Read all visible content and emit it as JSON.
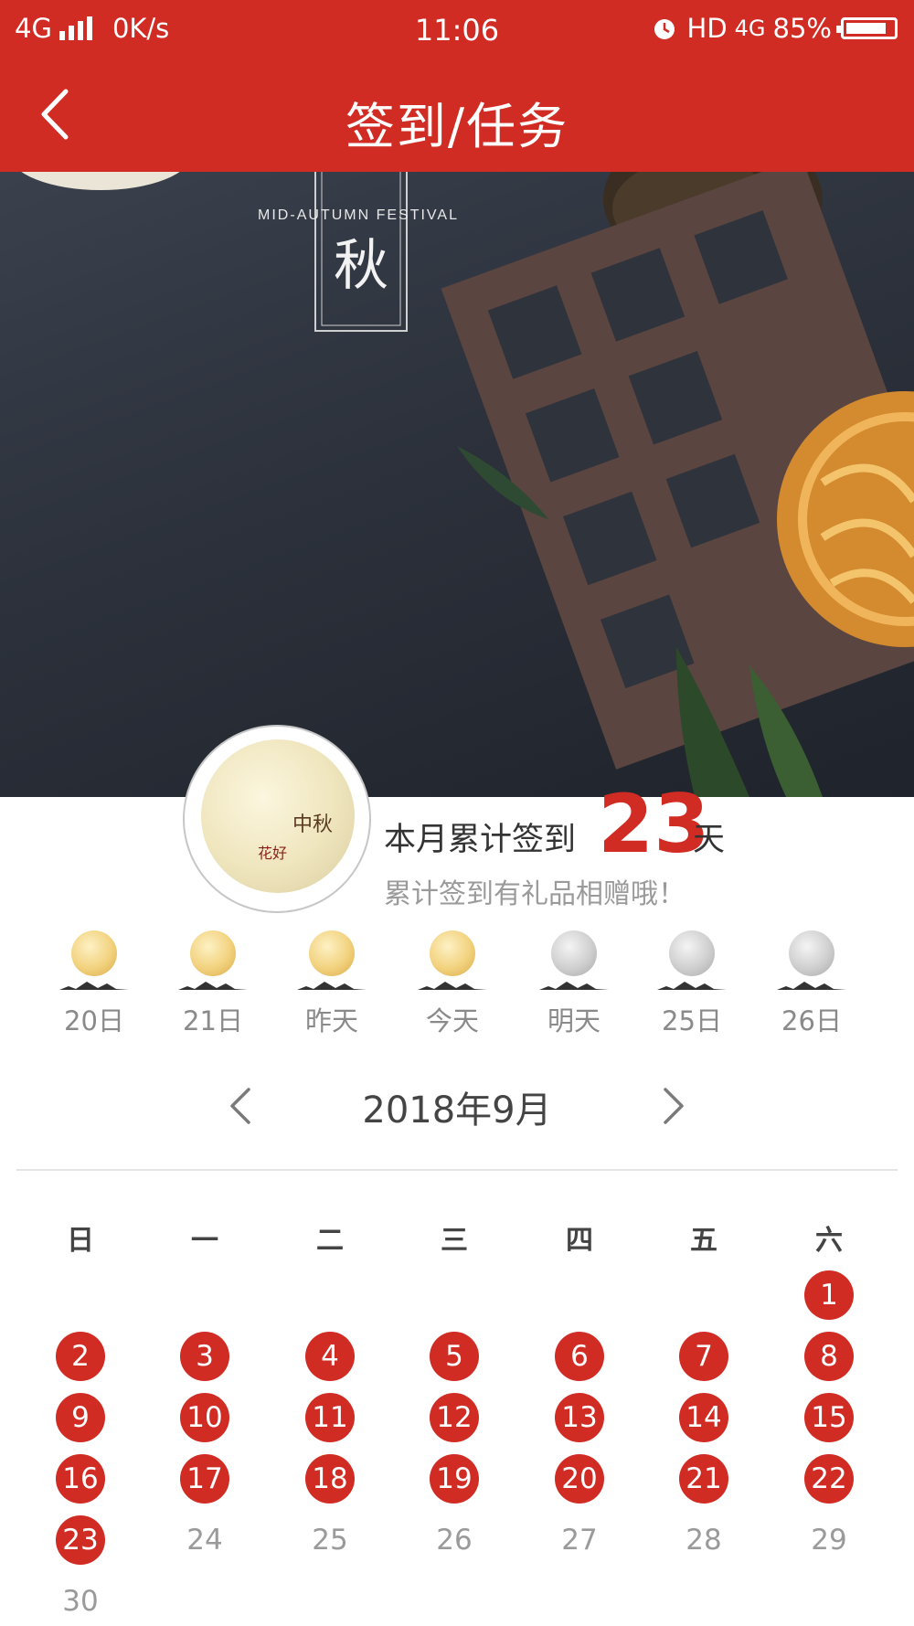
{
  "status_bar": {
    "network": "4G",
    "speed": "0K/s",
    "time": "11:06",
    "hd": "HD",
    "net2": "4G",
    "battery": "85%",
    "battery_level": 0.85
  },
  "header": {
    "title": "签到/任务",
    "back_icon": "chevron-left-icon"
  },
  "banner": {
    "festival_en": "MID-AUTUMN FESTIVAL",
    "festival_char": "秋"
  },
  "summary": {
    "prefix": "本月累计签到",
    "count": "23",
    "suffix": "天",
    "subtitle": "累计签到有礼品相赠哦！",
    "avatar_text_1": "花好",
    "avatar_text_2": "中秋"
  },
  "week_strip": [
    {
      "label": "20日",
      "signed": true
    },
    {
      "label": "21日",
      "signed": true
    },
    {
      "label": "昨天",
      "signed": true
    },
    {
      "label": "今天",
      "signed": true
    },
    {
      "label": "明天",
      "signed": false
    },
    {
      "label": "25日",
      "signed": false
    },
    {
      "label": "26日",
      "signed": false
    }
  ],
  "month_nav": {
    "title": "2018年9月",
    "prev_icon": "chevron-left-icon",
    "next_icon": "chevron-right-icon"
  },
  "calendar": {
    "weekdays": [
      "日",
      "一",
      "二",
      "三",
      "四",
      "五",
      "六"
    ],
    "days": [
      {
        "d": "1",
        "signed": true
      },
      {
        "d": "2",
        "signed": true
      },
      {
        "d": "3",
        "signed": true
      },
      {
        "d": "4",
        "signed": true
      },
      {
        "d": "5",
        "signed": true
      },
      {
        "d": "6",
        "signed": true
      },
      {
        "d": "7",
        "signed": true
      },
      {
        "d": "8",
        "signed": true
      },
      {
        "d": "9",
        "signed": true
      },
      {
        "d": "10",
        "signed": true
      },
      {
        "d": "11",
        "signed": true
      },
      {
        "d": "12",
        "signed": true
      },
      {
        "d": "13",
        "signed": true
      },
      {
        "d": "14",
        "signed": true
      },
      {
        "d": "15",
        "signed": true
      },
      {
        "d": "16",
        "signed": true
      },
      {
        "d": "17",
        "signed": true
      },
      {
        "d": "18",
        "signed": true
      },
      {
        "d": "19",
        "signed": true
      },
      {
        "d": "20",
        "signed": true
      },
      {
        "d": "21",
        "signed": true
      },
      {
        "d": "22",
        "signed": true
      },
      {
        "d": "23",
        "signed": true
      },
      {
        "d": "24",
        "signed": false
      },
      {
        "d": "25",
        "signed": false
      },
      {
        "d": "26",
        "signed": false
      },
      {
        "d": "27",
        "signed": false
      },
      {
        "d": "28",
        "signed": false
      },
      {
        "d": "29",
        "signed": false
      },
      {
        "d": "30",
        "signed": false
      }
    ]
  },
  "colors": {
    "accent": "#d12c24",
    "muted": "#9a9a9a"
  }
}
